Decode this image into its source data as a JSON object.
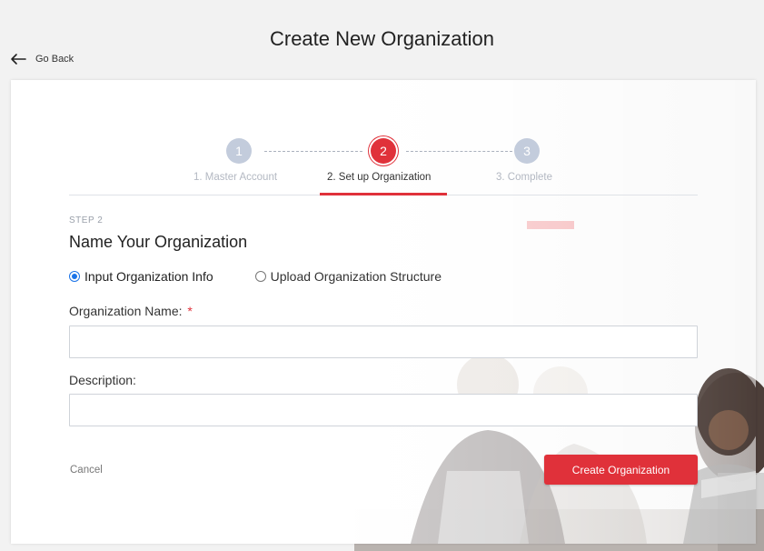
{
  "header": {
    "title": "Create New Organization",
    "go_back": "Go Back",
    "go_back_icon": "arrow-left-icon"
  },
  "stepper": {
    "steps": [
      {
        "number": "1",
        "label": "1. Master Account",
        "state": "inactive"
      },
      {
        "number": "2",
        "label": "2. Set up Organization",
        "state": "active"
      },
      {
        "number": "3",
        "label": "3. Complete",
        "state": "inactive"
      }
    ]
  },
  "form": {
    "eyebrow": "STEP 2",
    "title": "Name Your Organization",
    "mode_options": [
      {
        "label": "Input Organization Info",
        "checked": true
      },
      {
        "label": "Upload Organization Structure",
        "checked": false
      }
    ],
    "org_name_label": "Organization Name:",
    "required_marker": "*",
    "org_name_value": "",
    "description_label": "Description:",
    "description_value": "",
    "cancel_label": "Cancel",
    "submit_label": "Create Organization"
  },
  "colors": {
    "accent": "#e0313a",
    "step_inactive": "#c3ccdc",
    "radio_checked": "#1a73e8"
  }
}
